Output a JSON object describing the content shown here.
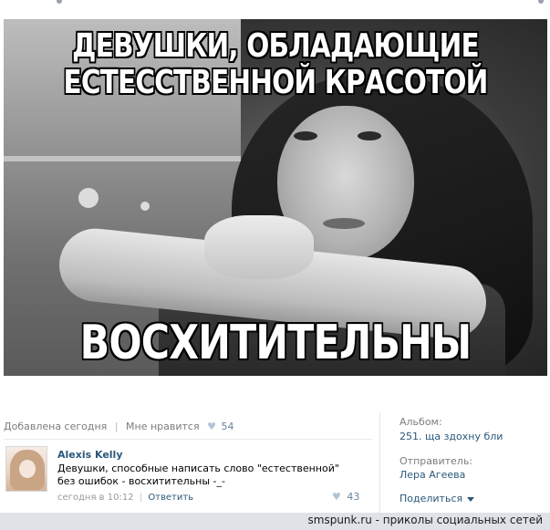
{
  "meme": {
    "top_line_1": "ДЕВУШКИ, ОБЛАДАЮЩИЕ",
    "top_line_2": "ЕСТЕССТВЕННОЙ КРАСОТОЙ",
    "bottom_line": "ВОСХИТИТЕЛЬНЫ"
  },
  "post_meta": {
    "added": "Добавлена сегодня",
    "like_label": "Мне нравится",
    "like_count": "54"
  },
  "comment": {
    "author": "Alexis Kelly",
    "text": "Девушки, способные написать слово \"естественной\" без ошибок - восхитительны -_-",
    "time": "сегодня в 10:12",
    "reply_label": "Ответить",
    "like_count": "43"
  },
  "sidebar": {
    "album_label": "Альбом:",
    "album_name": "251. ща здохну бли",
    "sender_label": "Отправитель:",
    "sender_name": "Лера Агеева",
    "share_label": "Поделиться"
  },
  "watermark": "smspunk.ru - приколы социальных сетей",
  "colors": {
    "link": "#2b587a",
    "meta": "#7c7c7c",
    "like": "#6b83a0"
  }
}
